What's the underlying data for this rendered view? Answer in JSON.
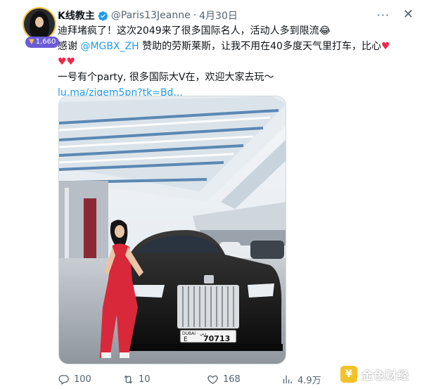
{
  "tweet": {
    "display_name": "K线教主",
    "handle": "@Paris13Jeanne",
    "separator": "·",
    "date": "4月30日",
    "badge_count": "1,660",
    "more_label": "···",
    "close_label": "✕",
    "lines": {
      "l1": "迪拜堵疯了！这次2049来了很多国际名人，活动人多到限流😂",
      "l2_pre": "感谢 ",
      "l2_mention": "@MGBX_ZH",
      "l2_post": " 赞助的劳斯莱斯，让我不用在40多度天气里打车，比心",
      "l2_heart": "♥",
      "l3_hearts": "♥♥",
      "l4": "一号有个party, 很多国际大V在，欢迎大家去玩～",
      "l5_link": "lu.ma/ziqem5pn?tk=Bd..."
    },
    "plate": {
      "emirate": "DUBAI · دبي",
      "letter": "E",
      "number": "70713"
    },
    "metrics": {
      "replies": "100",
      "retweets": "10",
      "likes": "168",
      "views": "4.9万"
    }
  },
  "watermark": {
    "logo_char": "¥",
    "text": "金色财经"
  },
  "colors": {
    "link": "#1d9bf0",
    "muted": "#536471",
    "heart": "#f0284a",
    "verified": "#1d9bf0",
    "badge": "#6b5bd6"
  }
}
